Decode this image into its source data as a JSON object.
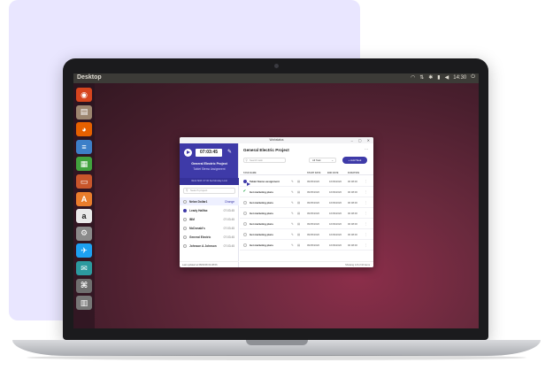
{
  "colors": {
    "panel": "#e9e6ff",
    "accent": "#3e3aa8",
    "ubuntu_panel": "#3c3b37",
    "desktop_dark": "#2f1620",
    "desktop_red": "#8c2e4a"
  },
  "desktop": {
    "topbar_title": "Desktop",
    "clock": "14:30",
    "tray_icons": [
      "wifi-icon",
      "arrows-icon",
      "bluetooth-icon",
      "battery-icon",
      "volume-icon",
      "power-icon"
    ]
  },
  "launcher": {
    "items": [
      {
        "icon": "ubuntu-icon",
        "glyph": "◉",
        "color": "#d6451e"
      },
      {
        "icon": "files-icon",
        "glyph": "▤",
        "color": "#9c8670"
      },
      {
        "icon": "firefox-icon",
        "glyph": "◕",
        "color": "#e66000"
      },
      {
        "icon": "writer-icon",
        "glyph": "≡",
        "color": "#3d7fc8"
      },
      {
        "icon": "calc-icon",
        "glyph": "▦",
        "color": "#41a33e"
      },
      {
        "icon": "impress-icon",
        "glyph": "▭",
        "color": "#c8562b"
      },
      {
        "icon": "software-center-icon",
        "glyph": "A",
        "color": "#e97d2c"
      },
      {
        "icon": "amazon-icon",
        "glyph": "a",
        "color": "#e9e9e9"
      },
      {
        "icon": "settings-icon",
        "glyph": "⚙",
        "color": "#8a8a8a"
      },
      {
        "icon": "twitter-icon",
        "glyph": "✈",
        "color": "#1da1f2"
      },
      {
        "icon": "app-icon",
        "glyph": "✉",
        "color": "#2c9a9f"
      },
      {
        "icon": "app-round-icon",
        "glyph": "⌘",
        "color": "#6f6f6f"
      },
      {
        "icon": "trash-icon",
        "glyph": "▥",
        "color": "#777777"
      }
    ]
  },
  "app": {
    "window_title": "Workstatus",
    "sidebar": {
      "timer": "07:03:45",
      "project": "General Electric Project",
      "task": "Tablet Stemo Assignment",
      "shift": "Work Shift: 07:30 Set Monday Limit",
      "search_placeholder": "Search project",
      "clients": [
        {
          "name": "Nelan Dollar1",
          "time": "Change",
          "active": true,
          "on": false,
          "link": true
        },
        {
          "name": "Leady Halifax",
          "time": "07:03:45",
          "active": false,
          "on": true,
          "link": false
        },
        {
          "name": "IBM",
          "time": "07:03:45",
          "active": false,
          "on": false,
          "link": false
        },
        {
          "name": "McDonald's",
          "time": "07:03:45",
          "active": false,
          "on": false,
          "link": false
        },
        {
          "name": "General Electric",
          "time": "07:03:45",
          "active": false,
          "on": false,
          "link": false
        },
        {
          "name": "Johnson & Johnson",
          "time": "07:03:45",
          "active": false,
          "on": false,
          "link": false
        }
      ],
      "footer": "Last updated at 08/02/06 04:38:06"
    },
    "main": {
      "title": "General Electric Project",
      "search_placeholder": "Search task",
      "filter": "All Task",
      "add_button": "+ Add Task",
      "columns": {
        "name": "TASK NAME",
        "start": "START DATE",
        "end": "END DATE",
        "duration": "DURATION"
      },
      "rows": [
        {
          "status": "play",
          "name": "Tablet Stemo assignment",
          "start": "09/05/2020",
          "end": "16/09/2020",
          "duration": "00:08:00"
        },
        {
          "status": "done",
          "name": "Get marketing plans",
          "start": "09/05/2020",
          "end": "16/09/2020",
          "duration": "00:08:00"
        },
        {
          "status": "todo",
          "name": "Get marketing plans",
          "start": "09/05/2020",
          "end": "16/09/2020",
          "duration": "00:08:00"
        },
        {
          "status": "todo",
          "name": "Get marketing plans",
          "start": "09/05/2020",
          "end": "16/09/2020",
          "duration": "00:08:00"
        },
        {
          "status": "todo",
          "name": "Get marketing plans",
          "start": "09/05/2020",
          "end": "16/09/2020",
          "duration": "00:08:00"
        },
        {
          "status": "todo",
          "name": "Get marketing plans",
          "start": "09/05/2020",
          "end": "16/09/2020",
          "duration": "00:08:00"
        },
        {
          "status": "todo",
          "name": "Get marketing plans",
          "start": "09/05/2020",
          "end": "16/09/2020",
          "duration": "00:08:00"
        }
      ],
      "footer": "Showing 1-8 of 10 items"
    }
  }
}
